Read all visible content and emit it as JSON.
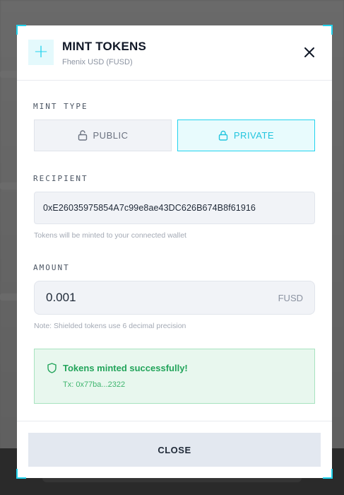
{
  "modal": {
    "title": "MINT TOKENS",
    "subtitle": "Fhenix USD (FUSD)",
    "header_icon": "plus-icon",
    "close_icon": "close-icon"
  },
  "mint_type": {
    "label": "MINT TYPE",
    "options": [
      {
        "label": "PUBLIC",
        "icon": "unlock-icon",
        "selected": false
      },
      {
        "label": "PRIVATE",
        "icon": "lock-icon",
        "selected": true
      }
    ]
  },
  "recipient": {
    "label": "RECIPIENT",
    "value": "0xE26035975854A7c99e8ae43DC626B674B8f61916",
    "helper": "Tokens will be minted to your connected wallet"
  },
  "amount": {
    "label": "AMOUNT",
    "value": "0.001",
    "unit": "FUSD",
    "helper": "Note: Shielded tokens use 6 decimal precision"
  },
  "status": {
    "icon": "shield-icon",
    "title": "Tokens minted successfully!",
    "tx": "Tx: 0x77ba...2322"
  },
  "footer": {
    "close_label": "CLOSE"
  },
  "colors": {
    "accent": "#22d3ee",
    "success": "#22a45a",
    "success_bg": "#e8f7ee"
  }
}
